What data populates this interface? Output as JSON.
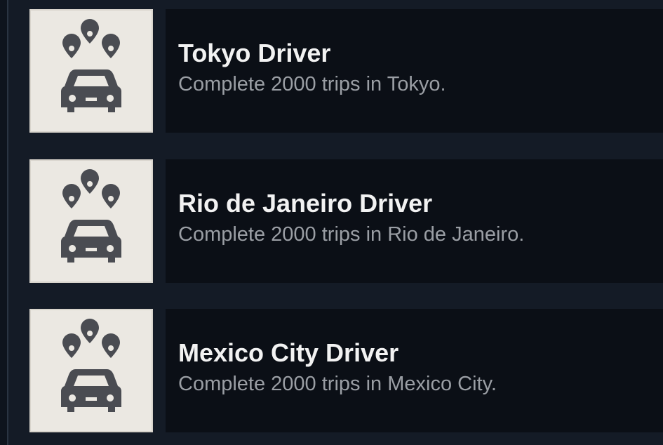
{
  "achievements": [
    {
      "title": "Tokyo Driver",
      "description": "Complete 2000 trips in Tokyo.",
      "icon": "car-with-location-pins-icon"
    },
    {
      "title": "Rio de Janeiro Driver",
      "description": "Complete 2000 trips in Rio de Janeiro.",
      "icon": "car-with-location-pins-icon"
    },
    {
      "title": "Mexico City Driver",
      "description": "Complete 2000 trips in Mexico City.",
      "icon": "car-with-location-pins-icon"
    }
  ],
  "colors": {
    "background": "#141b26",
    "panel": "#0b0f16",
    "icon_tile": "#ebe8e2",
    "icon_glyph": "#4a4c52",
    "title_text": "#f2f2f2",
    "description_text": "#9a9ea4"
  }
}
